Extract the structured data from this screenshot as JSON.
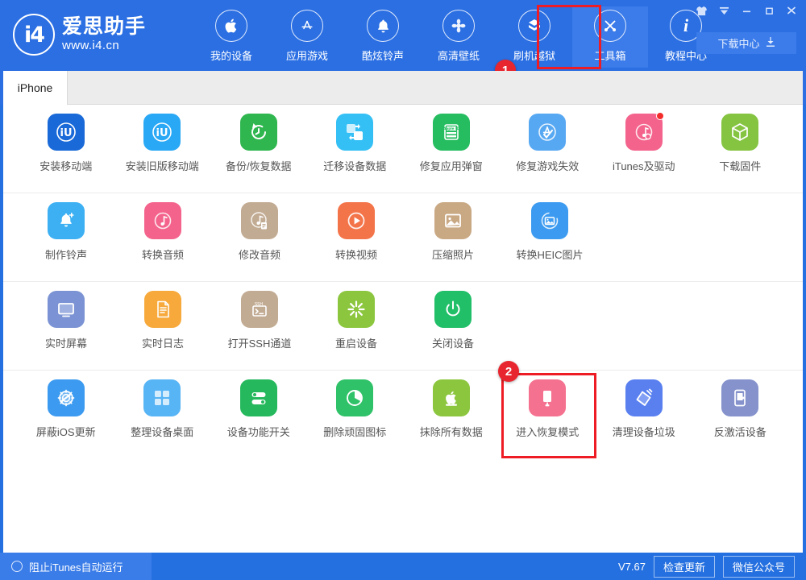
{
  "window": {
    "controls": [
      {
        "name": "skin-icon",
        "glyph": "skin"
      },
      {
        "name": "menu-arrow-icon",
        "glyph": "arrow"
      },
      {
        "name": "minimize-icon",
        "glyph": "minimize"
      },
      {
        "name": "maximize-icon",
        "glyph": "maximize"
      },
      {
        "name": "close-icon",
        "glyph": "close"
      }
    ]
  },
  "header": {
    "logo_mark": "i4",
    "logo_cn": "爱思助手",
    "logo_url": "www.i4.cn",
    "download_center": "下载中心",
    "nav": [
      {
        "label": "我的设备",
        "icon": "apple-icon"
      },
      {
        "label": "应用游戏",
        "icon": "appstore-icon"
      },
      {
        "label": "酷炫铃声",
        "icon": "bell-icon"
      },
      {
        "label": "高清壁纸",
        "icon": "flower-icon"
      },
      {
        "label": "刷机越狱",
        "icon": "box-icon"
      },
      {
        "label": "工具箱",
        "icon": "tools-icon",
        "active": true
      },
      {
        "label": "教程中心",
        "icon": "info-icon"
      }
    ]
  },
  "tabs": [
    {
      "label": "iPhone",
      "active": true
    }
  ],
  "annotations": {
    "marker_1": "1",
    "marker_2": "2"
  },
  "toolbox": {
    "rows": [
      [
        {
          "label": "安装移动端",
          "icon": "i4-app-icon",
          "color": "#1969d8",
          "dot": false
        },
        {
          "label": "安装旧版移动端",
          "icon": "i4-app-old-icon",
          "color": "#29a8f5",
          "dot": false
        },
        {
          "label": "备份/恢复数据",
          "icon": "backup-restore-icon",
          "color": "#2fb64f",
          "dot": false
        },
        {
          "label": "迁移设备数据",
          "icon": "migrate-data-icon",
          "color": "#35c0f5",
          "dot": false
        },
        {
          "label": "修复应用弹窗",
          "icon": "fix-appleid-popup-icon",
          "color": "#25bd60",
          "dot": false
        },
        {
          "label": "修复游戏失效",
          "icon": "fix-game-icon",
          "color": "#57a8f2",
          "dot": false
        },
        {
          "label": "iTunes及驱动",
          "icon": "itunes-driver-icon",
          "color": "#f4638c",
          "dot": true
        },
        {
          "label": "下载固件",
          "icon": "download-firmware-icon",
          "color": "#85c441",
          "dot": false
        }
      ],
      [
        {
          "label": "制作铃声",
          "icon": "make-ringtone-icon",
          "color": "#3cb0f3",
          "dot": false
        },
        {
          "label": "转换音频",
          "icon": "convert-audio-icon",
          "color": "#f4638c",
          "dot": false
        },
        {
          "label": "修改音频",
          "icon": "edit-audio-icon",
          "color": "#c2ab93",
          "dot": false
        },
        {
          "label": "转换视频",
          "icon": "convert-video-icon",
          "color": "#f4744a",
          "dot": false
        },
        {
          "label": "压缩照片",
          "icon": "compress-photo-icon",
          "color": "#c9a884",
          "dot": false
        },
        {
          "label": "转换HEIC图片",
          "icon": "convert-heic-icon",
          "color": "#3c9bf0",
          "dot": false
        }
      ],
      [
        {
          "label": "实时屏幕",
          "icon": "live-screen-icon",
          "color": "#7b93d4",
          "dot": false
        },
        {
          "label": "实时日志",
          "icon": "live-log-icon",
          "color": "#f7a93c",
          "dot": false
        },
        {
          "label": "打开SSH通道",
          "icon": "ssh-tunnel-icon",
          "color": "#c2ab93",
          "dot": false
        },
        {
          "label": "重启设备",
          "icon": "reboot-device-icon",
          "color": "#8cc63e",
          "dot": false
        },
        {
          "label": "关闭设备",
          "icon": "shutdown-device-icon",
          "color": "#20bf68",
          "dot": false
        }
      ],
      [
        {
          "label": "屏蔽iOS更新",
          "icon": "block-ios-update-icon",
          "color": "#3c9bf0",
          "dot": false
        },
        {
          "label": "整理设备桌面",
          "icon": "organize-desktop-icon",
          "color": "#57b4f5",
          "dot": false
        },
        {
          "label": "设备功能开关",
          "icon": "feature-toggle-icon",
          "color": "#25b85c",
          "dot": false
        },
        {
          "label": "删除顽固图标",
          "icon": "remove-stubborn-icon",
          "color": "#2fc268",
          "dot": false
        },
        {
          "label": "抹除所有数据",
          "icon": "erase-all-data-icon",
          "color": "#8cc63e",
          "dot": false
        },
        {
          "label": "进入恢复模式",
          "icon": "recovery-mode-icon",
          "color": "#f4718f",
          "dot": false,
          "highlight": true
        },
        {
          "label": "清理设备垃圾",
          "icon": "clean-junk-icon",
          "color": "#5a80f0",
          "dot": false
        },
        {
          "label": "反激活设备",
          "icon": "deactivate-device-icon",
          "color": "#8592cc",
          "dot": false
        }
      ]
    ]
  },
  "statusbar": {
    "block_itunes_label": "阻止iTunes自动运行",
    "version": "V7.67",
    "check_update": "检查更新",
    "wechat": "微信公众号"
  }
}
